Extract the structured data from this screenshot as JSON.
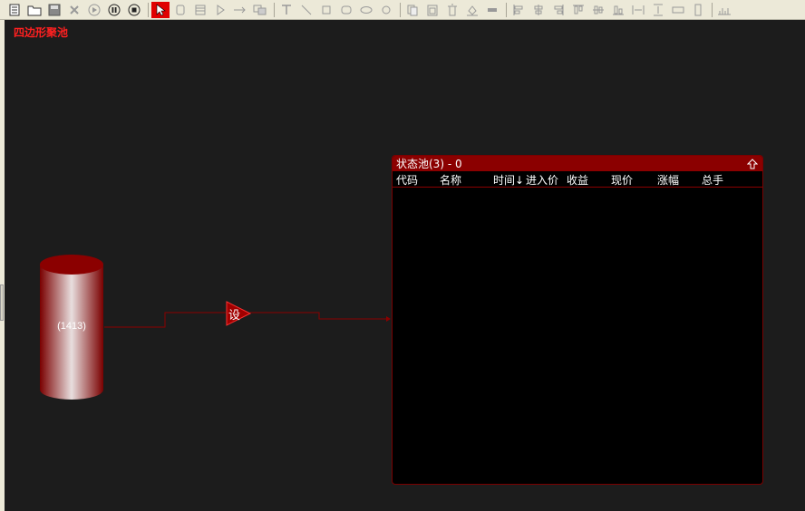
{
  "toolbar": {
    "buttons": [
      "new-doc-icon",
      "open-folder-icon",
      "save-icon",
      "delete-icon",
      "play-icon",
      "pause-icon",
      "stop-icon",
      "pointer-icon",
      "rect-tool-icon",
      "table-tool-icon",
      "triangle-tool-icon",
      "arrow-tool-icon",
      "group-tool-icon",
      "text-tool-icon",
      "line-tool-icon",
      "square-tool-icon",
      "rounded-rect-icon",
      "ellipse-icon",
      "circle-icon",
      "copy-icon",
      "paste-icon",
      "trash-icon",
      "fill-icon",
      "line-style-icon",
      "align-left-icon",
      "align-center-icon",
      "align-right-icon",
      "align-top-icon",
      "align-middle-icon",
      "align-bottom-icon",
      "space-horizontal-icon",
      "space-vertical-icon",
      "same-width-icon",
      "same-height-icon",
      "grid-icon"
    ],
    "active": "pointer-icon"
  },
  "canvas": {
    "pool_title": "四边形聚池",
    "source_count": "(1413)",
    "trigger_label": "设"
  },
  "panel": {
    "title": "状态池(3) - 0",
    "columns": [
      "代码",
      "名称",
      "时间↓",
      "进入价",
      "收益",
      "现价",
      "涨幅",
      "总手"
    ],
    "rows": []
  },
  "colors": {
    "accent": "#8b0000",
    "title_red": "#ff2020",
    "background": "#1c1c1c"
  }
}
